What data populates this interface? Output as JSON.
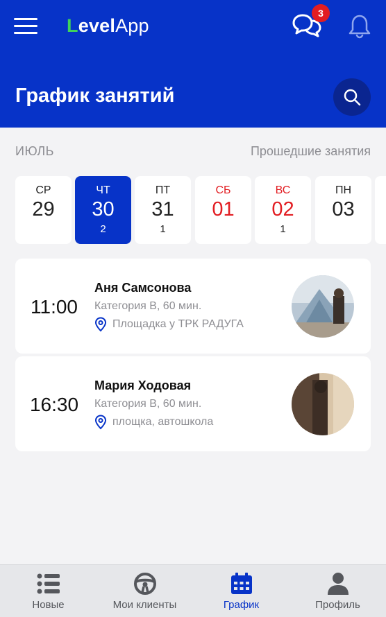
{
  "header": {
    "logo_prefix": "Level",
    "logo_suffix": "App",
    "chat_badge": "3",
    "title": "График занятий"
  },
  "schedule": {
    "month": "ИЮЛЬ",
    "past_link": "Прошедшие занятия"
  },
  "days": [
    {
      "dow": "СР",
      "num": "29",
      "count": ""
    },
    {
      "dow": "ЧТ",
      "num": "30",
      "count": "2"
    },
    {
      "dow": "ПТ",
      "num": "31",
      "count": "1"
    },
    {
      "dow": "СБ",
      "num": "01",
      "count": ""
    },
    {
      "dow": "ВС",
      "num": "02",
      "count": "1"
    },
    {
      "dow": "ПН",
      "num": "03",
      "count": ""
    }
  ],
  "lessons": [
    {
      "time": "11:00",
      "name": "Аня Самсонова",
      "category": "Категория B, 60 мин.",
      "location": "Площадка у ТРК РАДУГА"
    },
    {
      "time": "16:30",
      "name": "Мария Ходовая",
      "category": "Категория B, 60 мин.",
      "location": "площка, автошкола"
    }
  ],
  "tabs": [
    {
      "label": "Новые",
      "icon": "list-icon"
    },
    {
      "label": "Мои клиенты",
      "icon": "steering-wheel-icon"
    },
    {
      "label": "График",
      "icon": "calendar-icon"
    },
    {
      "label": "Профиль",
      "icon": "user-icon"
    }
  ],
  "colors": {
    "primary": "#0733c8",
    "badge": "#e21d22",
    "weekend": "#e21d22",
    "logo_accent": "#3fd35a"
  }
}
